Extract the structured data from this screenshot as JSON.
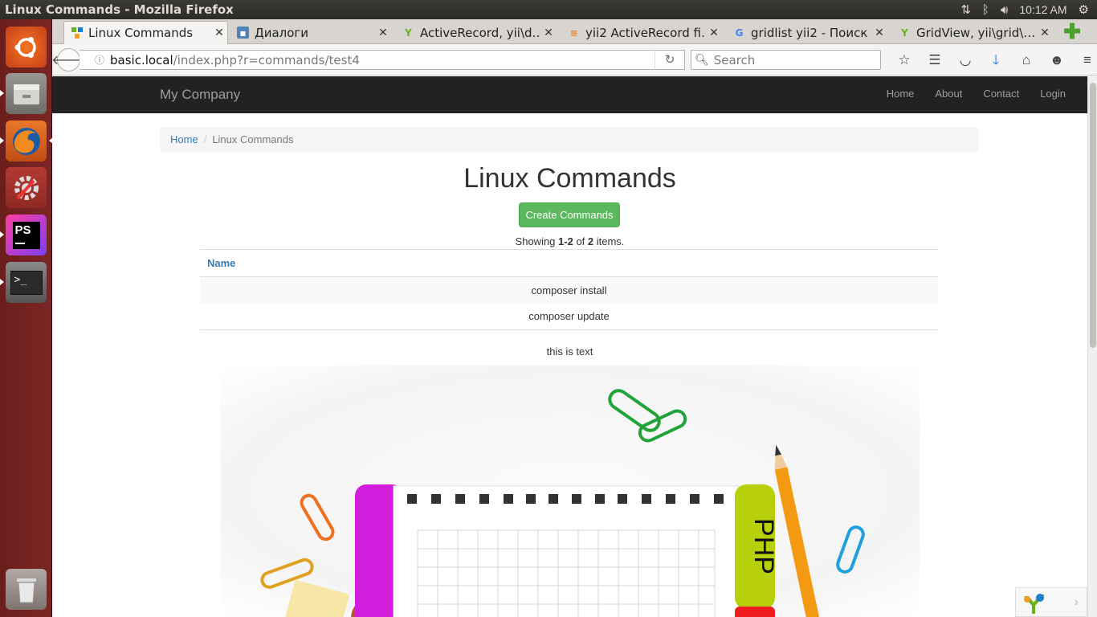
{
  "window": {
    "title": "Linux Commands - Mozilla Firefox",
    "clock": "10:12 AM"
  },
  "tray_icons": [
    "network-updown-icon",
    "bluetooth-icon",
    "volume-icon",
    "gear-icon"
  ],
  "launcher": [
    {
      "name": "ubuntu-dash-icon",
      "color": "#e95420"
    },
    {
      "name": "files-icon",
      "color": "#8c8a86"
    },
    {
      "name": "firefox-icon",
      "color": "#e66000"
    },
    {
      "name": "system-settings-icon",
      "color": "#c9c9c9"
    },
    {
      "name": "phpstorm-icon",
      "color": "#a33bd2",
      "label": "PS"
    },
    {
      "name": "terminal-icon",
      "color": "#3a3a3a",
      "label": ">_"
    },
    {
      "name": "trash-icon",
      "color": "#8a8a8a"
    }
  ],
  "tabs": [
    {
      "title": "Linux Commands",
      "active": true,
      "icon": "yii-logo-icon"
    },
    {
      "title": "Диалоги",
      "active": false,
      "icon": "vk-icon"
    },
    {
      "title": "ActiveRecord, yii\\d…",
      "active": false,
      "icon": "yii-logo-icon"
    },
    {
      "title": "yii2 ActiveRecord fi…",
      "active": false,
      "icon": "stackoverflow-icon"
    },
    {
      "title": "gridlist yii2 - Поиск …",
      "active": false,
      "icon": "google-icon"
    },
    {
      "title": "GridView, yii\\grid\\…",
      "active": false,
      "icon": "yii-logo-icon"
    }
  ],
  "url": {
    "host": "basic.local",
    "path": "/index.php?r=commands/test4"
  },
  "search": {
    "placeholder": "Search"
  },
  "site": {
    "brand": "My Company",
    "menu": [
      "Home",
      "About",
      "Contact",
      "Login"
    ]
  },
  "breadcrumb": {
    "home": "Home",
    "current": "Linux Commands"
  },
  "page": {
    "title": "Linux Commands",
    "create_button": "Create Commands",
    "summary_prefix": "Showing ",
    "summary_range": "1-2",
    "summary_of": " of ",
    "summary_total": "2",
    "summary_suffix": " items.",
    "caption": "this is text"
  },
  "grid": {
    "header": "Name",
    "rows": [
      "composer install",
      "composer update"
    ]
  },
  "hero": {
    "tab_label": "PHP"
  }
}
